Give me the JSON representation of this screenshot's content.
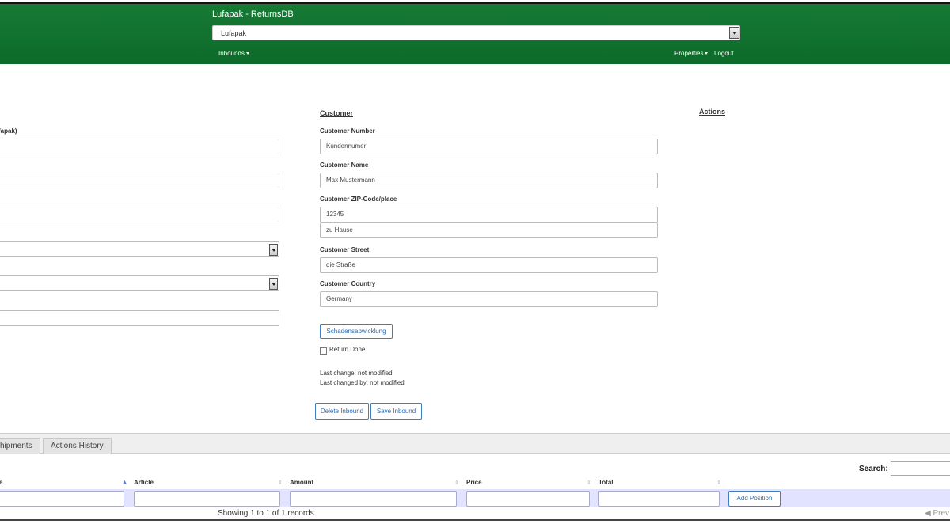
{
  "header": {
    "title": "Lufapak - ReturnsDB",
    "company_select": "Lufapak"
  },
  "nav": {
    "inbounds": "Inbounds",
    "properties": "Properties",
    "logout": "Logout"
  },
  "left": {
    "label_partial": "fapak)"
  },
  "customer": {
    "heading": "Customer",
    "number_label": "Customer Number",
    "number_value": "Kundennumer",
    "name_label": "Customer Name",
    "name_value": "Max Mustermann",
    "zip_label": "Customer ZIP-Code/place",
    "zip_value": "12345",
    "place_value": "zu Hause",
    "street_label": "Customer Street",
    "street_value": "die Straße",
    "country_label": "Customer Country",
    "country_value": "Germany",
    "schaden_button": "Schadensabwicklung",
    "return_done": "Return Done",
    "last_change": "Last change: not modified",
    "last_changed_by": "Last changed by: not modified",
    "delete_button": "Delete Inbound",
    "save_button": "Save Inbound"
  },
  "actions": {
    "heading": "Actions"
  },
  "tabs": {
    "shipments": "hipments",
    "actions_history": "Actions History"
  },
  "table": {
    "search_label": "Search:",
    "columns": [
      "e",
      "Article",
      "Amount",
      "Price",
      "Total"
    ],
    "add_position": "Add Position",
    "info": "Showing 1 to 1 of 1 records",
    "prev": "Prev"
  }
}
